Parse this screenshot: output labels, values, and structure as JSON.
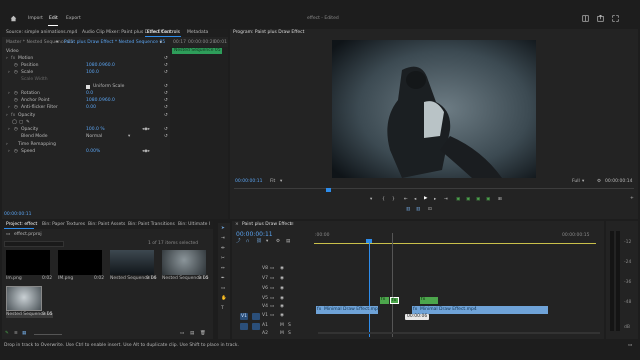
{
  "app": {
    "menu": [
      "Import",
      "Edit",
      "Export"
    ],
    "active_menu": "Edit",
    "project_name": "effect - Edited"
  },
  "source_panel": {
    "tabs": [
      "Source: simple animations.mp4",
      "Audio Clip Mixer: Paint plus Draw Effect",
      "Effect Controls",
      "Metadata"
    ],
    "active_tab": "Effect Controls",
    "master_label": "Master * Nested Sequence 05",
    "clip_label": "Paint plus Draw Effect * Nested Sequence 05",
    "timecode_start": "00:17",
    "timecode_mid": "00:00:00:20",
    "timecode_end": "00:01",
    "clip_bar_label": "Nested Sequence 05",
    "section_video": "Video",
    "current_time": "00:00:00:11"
  },
  "effect_controls": {
    "motion": "Motion",
    "position_label": "Position",
    "position_x": "1080.0",
    "position_y": "960.0",
    "scale_label": "Scale",
    "scale_value": "100.0",
    "scale_width_label": "Scale Width",
    "uniform_scale": "Uniform Scale",
    "rotation_label": "Rotation",
    "rotation_value": "0.0",
    "anchor_label": "Anchor Point",
    "anchor_x": "1080.0",
    "anchor_y": "960.0",
    "antiflicker_label": "Anti-flicker Filter",
    "antiflicker_value": "0.00",
    "opacity_section": "Opacity",
    "opacity_label": "Opacity",
    "opacity_value": "100.0 %",
    "blend_label": "Blend Mode",
    "blend_value": "Normal",
    "time_remap": "Time Remapping",
    "speed_label": "Speed",
    "speed_value": "0.00%"
  },
  "program": {
    "title": "Program: Paint plus Draw Effect",
    "timecode": "00:00:00:11",
    "fit": "Fit",
    "quality": "Full",
    "duration": "00:00:00:14"
  },
  "project_panel": {
    "tabs": [
      "Project: effect",
      "Bin: Paper Textures",
      "Bin: Paint Assets",
      "Bin: Paint Transitions",
      "Bin: Ultimate I"
    ],
    "active_tab": "Project: effect",
    "project_file": "effect.prproj",
    "items_count": "1 of 17 items selected",
    "items": [
      {
        "name": "Im.png",
        "duration": "0:02"
      },
      {
        "name": "IM.png",
        "duration": "0:02"
      },
      {
        "name": "Nested Sequence 06",
        "duration": "0:14"
      },
      {
        "name": "Nested Sequence 05",
        "duration": "0:14"
      },
      {
        "name": "Nested Sequence 05",
        "duration": "0:14"
      }
    ]
  },
  "timeline": {
    "tab": "Paint plus Draw Effect",
    "timecode": "00:00:00:11",
    "ruler_left": ":00:00",
    "ruler_right": "00:00:00:15",
    "video_tracks": [
      "V8",
      "V7",
      "V6",
      "V5",
      "V4",
      "V3",
      "V2",
      "V1"
    ],
    "audio_tracks": [
      "A1",
      "A2"
    ],
    "v1_label": "V1",
    "clip_a": "Minimal Draw Effect.mp4",
    "clip_b": "Minimal Draw Effect.mp4",
    "small_clips": [
      "fx",
      "fx",
      "fx"
    ],
    "tooltip": "00:00:06",
    "meter_labels": [
      "-12",
      "-24",
      "-36",
      "-48",
      "dB"
    ]
  },
  "status": {
    "message": "Drop in track to Overwrite. Use Ctrl to enable insert. Use Alt to duplicate clip. Use Shift to place in track."
  },
  "colors": {
    "accent": "#2d8ceb",
    "clip_blue": "#6fa3d8",
    "clip_green": "#4ca64c",
    "label_green": "#2e9d5a",
    "playhead": "#2d8ceb"
  }
}
